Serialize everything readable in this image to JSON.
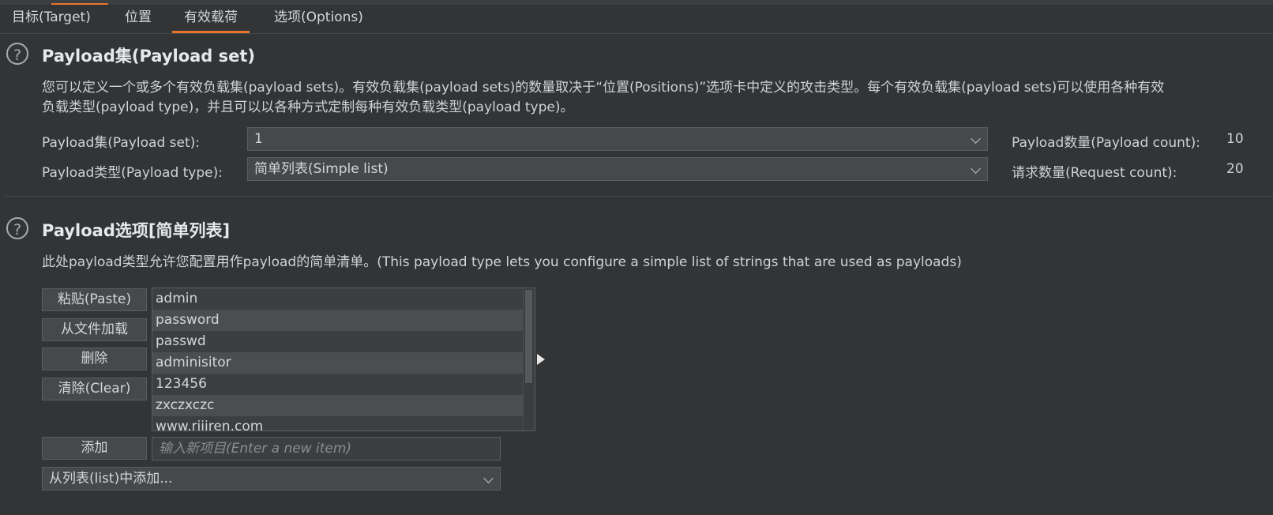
{
  "tabs": [
    {
      "label": "目标(Target)"
    },
    {
      "label": "位置"
    },
    {
      "label": "有效载荷",
      "active": true
    },
    {
      "label": "选项(Options)"
    }
  ],
  "payload_set_section": {
    "help_glyph": "?",
    "title": "Payload集(Payload set)",
    "desc_line1": "您可以定义一个或多个有效负载集(payload sets)。有效负载集(payload sets)的数量取决于“位置(Positions)”选项卡中定义的攻击类型。每个有效负载集(payload sets)可以使用各种有效",
    "desc_line2": "负载类型(payload type)，并且可以以各种方式定制每种有效负载类型(payload type)。",
    "set_label": "Payload集(Payload set):",
    "set_value": "1",
    "type_label": "Payload类型(Payload type):",
    "type_value": "简单列表(Simple list)",
    "count_label": "Payload数量(Payload count):",
    "count_value": "10",
    "request_label": "请求数量(Request count):",
    "request_value": "20"
  },
  "payload_options_section": {
    "help_glyph": "?",
    "title": "Payload选项[简单列表]",
    "desc": "此处payload类型允许您配置用作payload的简单清单。(This payload type lets you configure a simple list of strings that are used as payloads)",
    "buttons": {
      "paste": "粘贴(Paste)",
      "load": "从文件加载",
      "remove": "删除",
      "clear": "清除(Clear)",
      "add": "添加"
    },
    "list_items": [
      "admin",
      "password",
      "passwd",
      "adminisitor",
      "123456",
      "zxczxczc",
      "www.rijiren.com"
    ],
    "new_item_placeholder": "输入新项目(Enter a new item)",
    "add_from_list": "从列表(list)中添加..."
  },
  "colors": {
    "background": "#323436",
    "accent": "#e8742e"
  }
}
